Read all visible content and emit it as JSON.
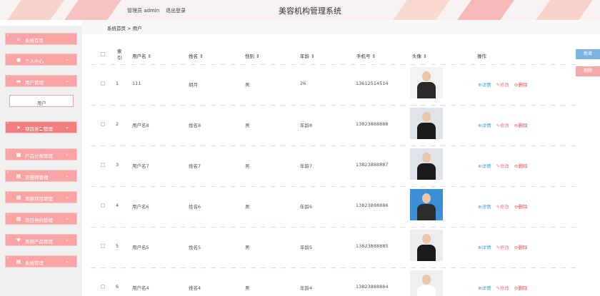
{
  "header": {
    "user_text": "管理员 admin",
    "logout": "退出登录",
    "title": "美容机构管理系统"
  },
  "breadcrumb": {
    "home": "系统首页",
    "sep": ">",
    "current": "用户"
  },
  "sidebar": {
    "items": [
      {
        "label": "系统首页",
        "icon": "home-icon",
        "glyph": "⌂",
        "has_chevron": false
      },
      {
        "label": "个人中心",
        "icon": "person-icon",
        "glyph": "●",
        "has_chevron": true
      },
      {
        "label": "用户管理",
        "icon": "briefcase-icon",
        "glyph": "▬",
        "has_chevron": true
      },
      {
        "label": "项目类型管理",
        "icon": "send-icon",
        "glyph": "➤",
        "has_chevron": true
      },
      {
        "label": "产品分类管理",
        "icon": "square-icon",
        "glyph": "■",
        "has_chevron": true
      },
      {
        "label": "美容师管理",
        "icon": "grid-icon",
        "glyph": "▦",
        "has_chevron": true
      },
      {
        "label": "美容项目管理",
        "icon": "grid-icon",
        "glyph": "▦",
        "has_chevron": true
      },
      {
        "label": "项目预约管理",
        "icon": "grid-icon",
        "glyph": "▦",
        "has_chevron": true
      },
      {
        "label": "美容产品管理",
        "icon": "heart-icon",
        "glyph": "♥",
        "has_chevron": true
      },
      {
        "label": "系统管理",
        "icon": "grid-icon",
        "glyph": "▦",
        "has_chevron": true
      }
    ],
    "submenu_label": "用户"
  },
  "buttons": {
    "add": "新增",
    "delete": "删除"
  },
  "table": {
    "columns": {
      "index": "索引",
      "username": "用户名 ⇕",
      "name": "姓名 ⇕",
      "gender": "性别 ⇕",
      "age": "年龄 ⇕",
      "phone": "手机号 ⇕",
      "avatar": "头像 ⇕",
      "actions": "操作"
    },
    "actions": {
      "detail": "⊕详情",
      "edit": "✎修改",
      "delete": "⊖删除"
    },
    "rows": [
      {
        "index": "1",
        "username": "111",
        "name": "胡月",
        "gender": "男",
        "age": "26",
        "phone": "13612514514"
      },
      {
        "index": "2",
        "username": "用户名8",
        "name": "姓名8",
        "gender": "男",
        "age": "年龄8",
        "phone": "13823888888"
      },
      {
        "index": "3",
        "username": "用户名7",
        "name": "姓名7",
        "gender": "男",
        "age": "年龄7",
        "phone": "13823888887"
      },
      {
        "index": "4",
        "username": "用户名6",
        "name": "姓名6",
        "gender": "男",
        "age": "年龄6",
        "phone": "13823888886"
      },
      {
        "index": "5",
        "username": "用户名5",
        "name": "姓名5",
        "gender": "男",
        "age": "年龄5",
        "phone": "13823888885"
      },
      {
        "index": "6",
        "username": "用户名4",
        "name": "姓名4",
        "gender": "男",
        "age": "年龄4",
        "phone": "13823888884"
      }
    ]
  },
  "colors": {
    "accent": "#f9a5a5",
    "accent_dark": "#f08080",
    "add_button": "#7fb3e0",
    "delete_button": "#f4a9a9",
    "detail": "#46a3d8",
    "delete": "#e05050"
  }
}
